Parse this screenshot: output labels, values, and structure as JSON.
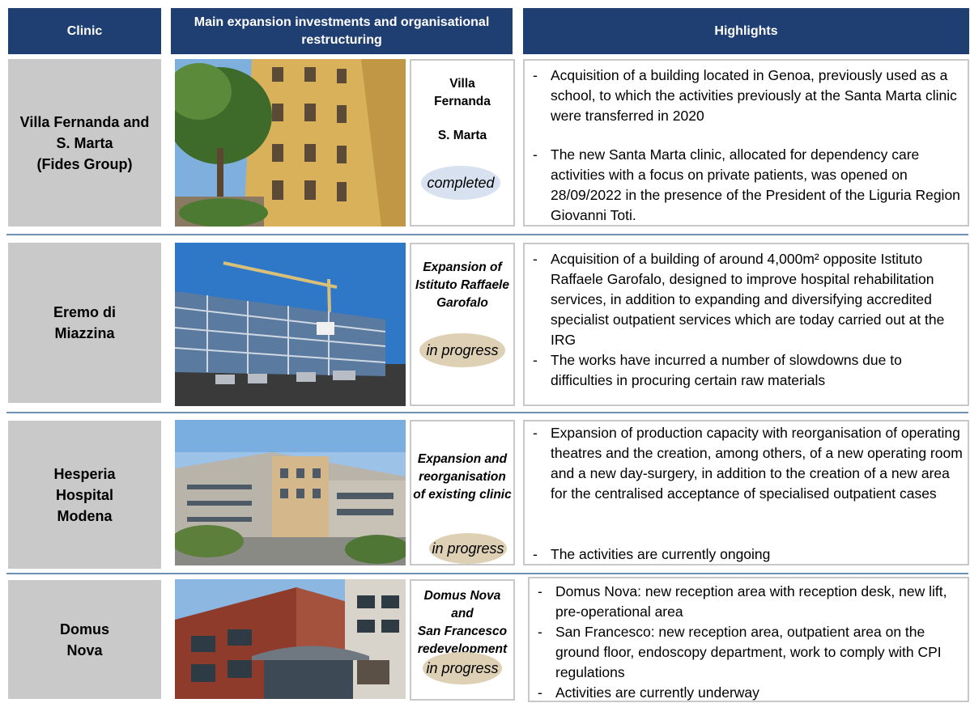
{
  "headers": {
    "clinic": "Clinic",
    "investments": "Main expansion investments and organisational restructuring",
    "highlights": "Highlights"
  },
  "rows": [
    {
      "clinic": "Villa Fernanda and\nS. Marta\n(Fides Group)",
      "project_line1": "Villa\nFernanda",
      "project_line2": "S. Marta",
      "status": "completed",
      "highlights": [
        "Acquisition of a building located in Genoa, previously used as a school, to which the activities previously at the Santa Marta clinic were transferred in 2020",
        "The new Santa Marta clinic, allocated for dependency care activities with a focus on private patients, was opened on 28/09/2022 in the presence of the President of the Liguria Region Giovanni Toti."
      ]
    },
    {
      "clinic": "Eremo di\nMiazzina",
      "project": "Expansion of\nIstituto Raffaele\nGarofalo",
      "status": "in progress",
      "highlights": [
        "Acquisition of a building of around 4,000m² opposite Istituto Raffaele Garofalo, designed to improve hospital rehabilitation services, in addition to expanding and diversifying accredited specialist outpatient services which are today carried out at the IRG",
        "The works have incurred a number of slowdowns due to difficulties in procuring certain raw materials"
      ]
    },
    {
      "clinic": "Hesperia\nHospital\nModena",
      "project": "Expansion and\nreorganisation\nof existing clinic",
      "status": "in progress",
      "highlights": [
        "Expansion of production capacity with reorganisation of operating theatres and the creation, among others, of a new operating room and a new day-surgery, in addition to the creation of a new area for the centralised acceptance of specialised outpatient cases",
        "The activities are currently ongoing"
      ]
    },
    {
      "clinic": "Domus\nNova",
      "project": "Domus Nova and\nSan Francesco\nredevelopment",
      "status": "in progress",
      "highlights": [
        "Domus Nova: new reception area with reception desk, new lift, pre-operational area",
        "San Francesco: new reception area, outpatient area on the ground floor, endoscopy department, work to comply with CPI regulations",
        "Activities are currently underway"
      ]
    }
  ],
  "colors": {
    "header_bg": "#1f3f73",
    "clinic_bg": "#c9c9c9",
    "status_in_progress": "#ddd0b5",
    "status_completed": "#d8e1ef"
  }
}
